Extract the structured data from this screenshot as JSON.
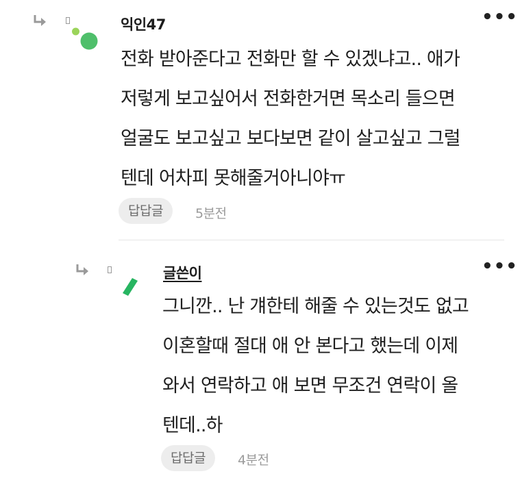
{
  "comments": [
    {
      "username": "익인47",
      "is_author": false,
      "lines": [
        "전화 받아준다고 전화만 할 수 있겠냐고.. 애가",
        "저렇게 보고싶어서 전화한거면 목소리 들으면",
        "얼굴도 보고싶고 보다보면 같이 살고싶고 그럴",
        "텐데 어차피 못해줄거아니야ㅠ"
      ],
      "reaction_label": "답답글",
      "time": "5분전",
      "more_label": "•••",
      "avatar_colors": [
        "#9bd45a",
        "#4fbf6b"
      ]
    },
    {
      "username": "글쓴이",
      "is_author": true,
      "lines": [
        "그니깐.. 난 걔한테 해줄 수 있는것도 없고",
        "이혼할때 절대 애 안 본다고 했는데 이제",
        "와서 연락하고 애 보면 무조건 연락이 올",
        "텐데..하"
      ],
      "reaction_label": "답답글",
      "time": "4분전",
      "more_label": "•••",
      "avatar_colors": [
        "#27b561"
      ]
    }
  ]
}
